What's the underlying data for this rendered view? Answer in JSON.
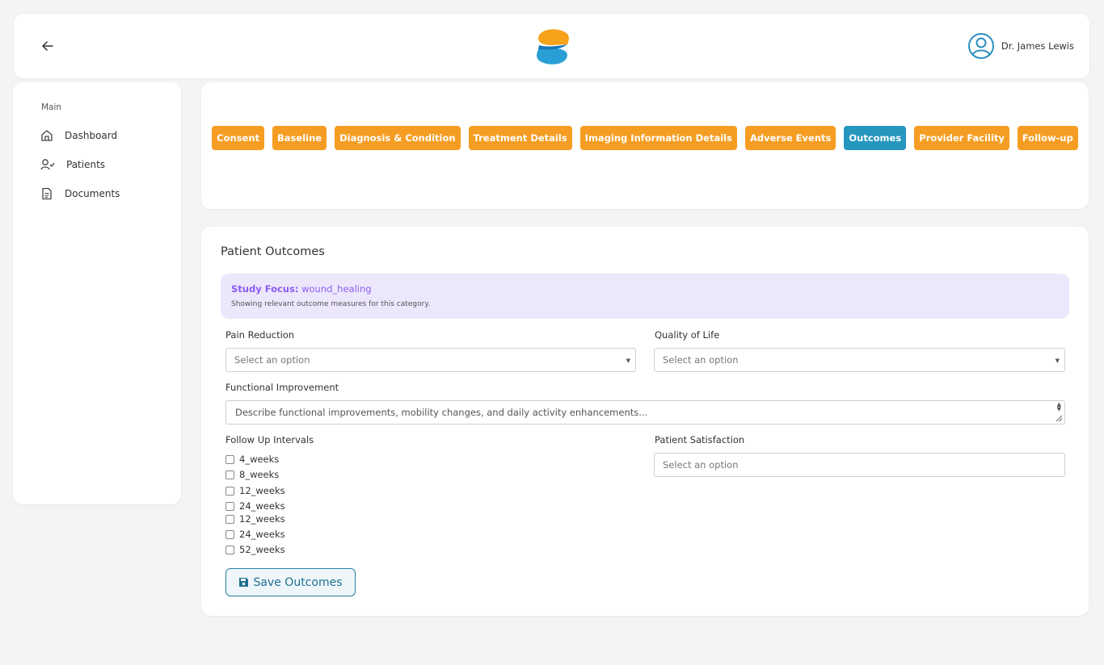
{
  "header": {
    "user_name": "Dr. James Lewis"
  },
  "sidebar": {
    "section_label": "Main",
    "items": [
      {
        "label": "Dashboard",
        "icon": "home-icon"
      },
      {
        "label": "Patients",
        "icon": "user-check-icon"
      },
      {
        "label": "Documents",
        "icon": "document-icon"
      }
    ]
  },
  "tabs": [
    {
      "label": "Consent",
      "active": false
    },
    {
      "label": "Baseline",
      "active": false
    },
    {
      "label": "Diagnosis & Condition",
      "active": false
    },
    {
      "label": "Treatment Details",
      "active": false
    },
    {
      "label": "Imaging Information Details",
      "active": false
    },
    {
      "label": "Adverse Events",
      "active": false
    },
    {
      "label": "Outcomes",
      "active": true
    },
    {
      "label": "Provider Facility",
      "active": false
    },
    {
      "label": "Follow-up",
      "active": false
    }
  ],
  "colors": {
    "tab": "#f59d22",
    "tab_active": "#2596be",
    "focus_bg": "#ede7fb",
    "focus_text": "#8b5cf6"
  },
  "form": {
    "title": "Patient Outcomes",
    "study_focus_label": "Study Focus:",
    "study_focus_value": "wound_healing",
    "study_focus_note": "Showing relevant outcome measures for this category.",
    "pain_reduction": {
      "label": "Pain Reduction",
      "placeholder": "Select an option"
    },
    "quality_of_life": {
      "label": "Quality of Life",
      "placeholder": "Select an option"
    },
    "functional_improvement": {
      "label": "Functional Improvement",
      "placeholder": "Describe functional improvements, mobility changes, and daily activity enhancements..."
    },
    "follow_up_intervals": {
      "label": "Follow Up Intervals",
      "options": [
        "4_weeks",
        "8_weeks",
        "12_weeks",
        "24_weeks",
        "12_weeks",
        "24_weeks",
        "52_weeks"
      ]
    },
    "patient_satisfaction": {
      "label": "Patient Satisfaction",
      "placeholder": "Select an option"
    },
    "save_label": "Save Outcomes"
  }
}
